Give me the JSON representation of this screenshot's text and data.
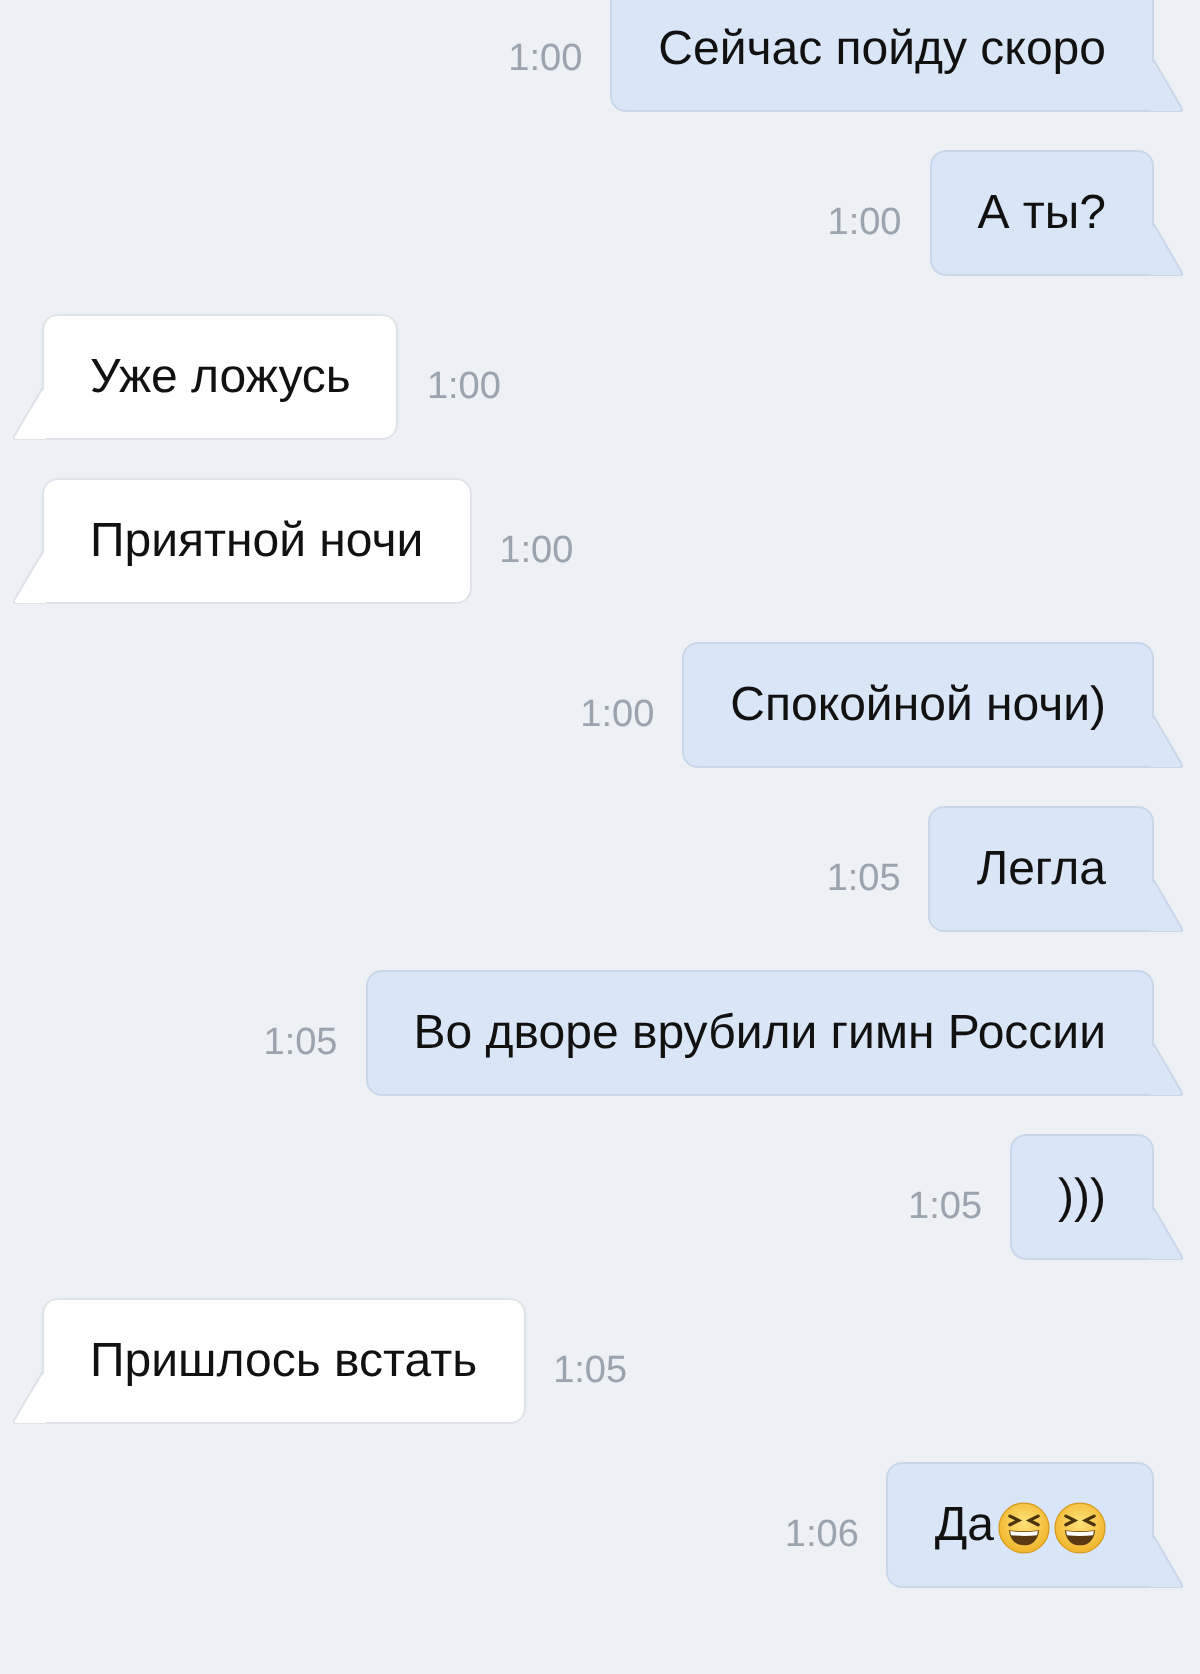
{
  "messages": [
    {
      "kind": "outgoing",
      "text": "Сейчас пойду скоро",
      "time": "1:00"
    },
    {
      "kind": "outgoing",
      "text": "А ты?",
      "time": "1:00"
    },
    {
      "kind": "incoming",
      "text": "Уже ложусь",
      "time": "1:00"
    },
    {
      "kind": "incoming",
      "text": "Приятной ночи",
      "time": "1:00"
    },
    {
      "kind": "outgoing",
      "text": "Спокойной ночи)",
      "time": "1:00"
    },
    {
      "kind": "outgoing",
      "text": "Легла",
      "time": "1:05"
    },
    {
      "kind": "outgoing",
      "text": "Во дворе врубили гимн России",
      "time": "1:05"
    },
    {
      "kind": "outgoing",
      "text": ")))",
      "time": "1:05"
    },
    {
      "kind": "incoming",
      "text": "Пришлось встать",
      "time": "1:05"
    },
    {
      "kind": "outgoing",
      "text": "Да",
      "time": "1:06",
      "emoji": [
        {
          "kind": "laughing"
        },
        {
          "kind": "laughing"
        }
      ]
    }
  ]
}
